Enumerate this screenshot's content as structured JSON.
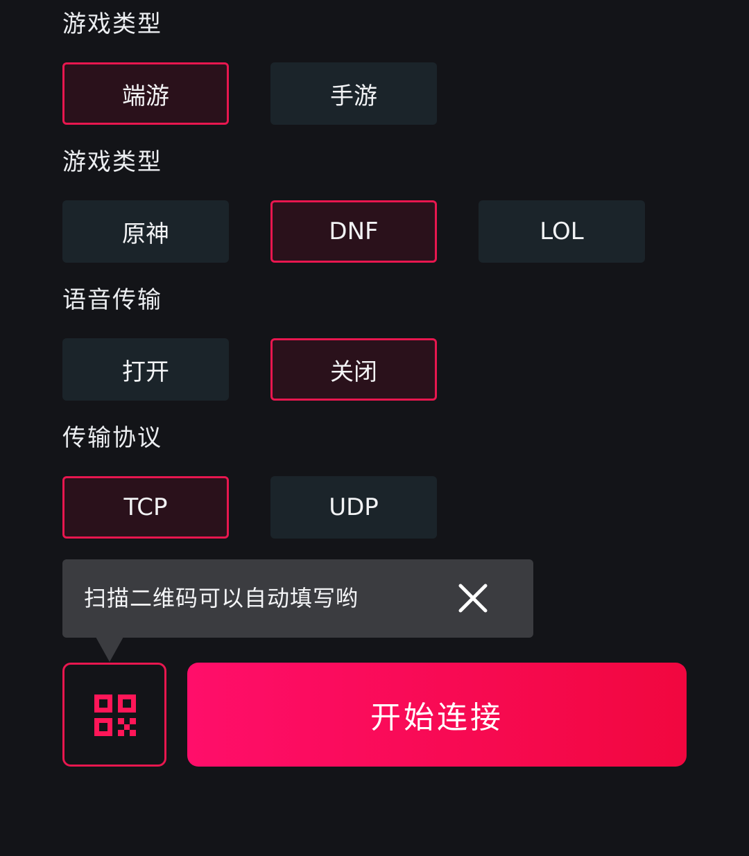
{
  "sections": [
    {
      "label": "游戏类型",
      "options": [
        {
          "text": "端游",
          "selected": true
        },
        {
          "text": "手游",
          "selected": false
        }
      ]
    },
    {
      "label": "游戏类型",
      "options": [
        {
          "text": "原神",
          "selected": false
        },
        {
          "text": "DNF",
          "selected": true
        },
        {
          "text": "LOL",
          "selected": false
        }
      ]
    },
    {
      "label": "语音传输",
      "options": [
        {
          "text": "打开",
          "selected": false
        },
        {
          "text": "关闭",
          "selected": true
        }
      ]
    },
    {
      "label": "传输协议",
      "options": [
        {
          "text": "TCP",
          "selected": true
        },
        {
          "text": "UDP",
          "selected": false
        }
      ]
    }
  ],
  "tooltip": {
    "text": "扫描二维码可以自动填写哟",
    "close_icon": "close-icon"
  },
  "qr_button": {
    "icon": "qr-code-icon"
  },
  "connect_button": {
    "label": "开始连接"
  },
  "colors": {
    "background": "#131418",
    "option_bg": "#1b242a",
    "selected_bg": "#2a111b",
    "accent": "#e8174f",
    "tooltip_bg": "#3b3c40"
  }
}
